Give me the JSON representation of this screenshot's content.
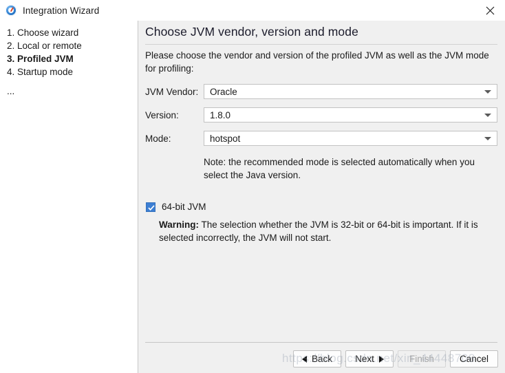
{
  "window": {
    "title": "Integration Wizard",
    "app_icon": "jprofiler-icon",
    "close_icon": "close-icon",
    "accent_color": "#3d7fd3",
    "panel_bg": "#f0f0f0",
    "sidebar_bg": "#ffffff"
  },
  "sidebar": {
    "items": [
      {
        "label": "1. Choose wizard",
        "current": false
      },
      {
        "label": "2. Local or remote",
        "current": false
      },
      {
        "label": "3. Profiled JVM",
        "current": true
      },
      {
        "label": "4. Startup mode",
        "current": false
      }
    ],
    "more_label": "..."
  },
  "main": {
    "heading": "Choose JVM vendor, version and mode",
    "description": "Please choose the vendor and version of the profiled JVM as well as the JVM mode for profiling:",
    "fields": [
      {
        "label": "JVM Vendor:",
        "value": "Oracle",
        "arrow_icon": "chevron-down-icon"
      },
      {
        "label": "Version:",
        "value": "1.8.0",
        "arrow_icon": "chevron-down-icon"
      },
      {
        "label": "Mode:",
        "value": "hotspot",
        "arrow_icon": "chevron-down-icon"
      }
    ],
    "note": "Note: the recommended mode is selected automatically when you select the Java version.",
    "checkbox": {
      "label": "64-bit JVM",
      "checked": true
    },
    "warning_prefix": "Warning:",
    "warning_text": " The selection whether the JVM is 32-bit or 64-bit is important. If it is selected incorrectly, the JVM will not start."
  },
  "buttons": {
    "back": "Back",
    "next": "Next",
    "finish": "Finish",
    "cancel": "Cancel",
    "finish_disabled": true
  },
  "watermark": {
    "text": "https://blog.csdn.net/xin_44448708"
  }
}
